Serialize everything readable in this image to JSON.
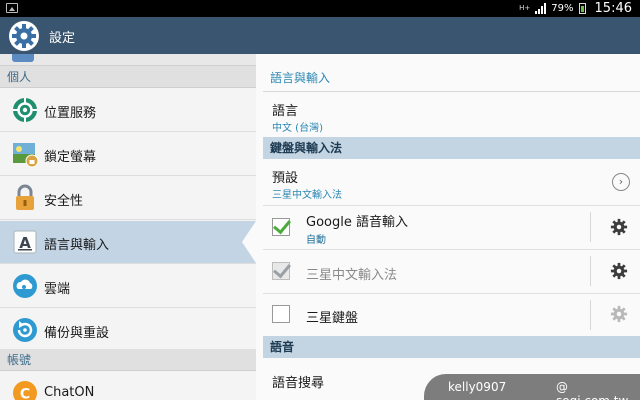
{
  "status_bar": {
    "network": "H+",
    "battery": "79%",
    "time": "15:46"
  },
  "action_bar": {
    "title": "設定",
    "icon": "settings-gear-icon"
  },
  "sidebar": {
    "sections": [
      {
        "label": "個人"
      },
      {
        "label": "帳號"
      }
    ],
    "items": [
      {
        "label": "位置服務",
        "icon": "location-icon"
      },
      {
        "label": "鎖定螢幕",
        "icon": "lock-screen-icon"
      },
      {
        "label": "安全性",
        "icon": "padlock-icon"
      },
      {
        "label": "語言與輸入",
        "icon": "keyboard-a-icon"
      },
      {
        "label": "雲端",
        "icon": "cloud-icon"
      },
      {
        "label": "備份與重設",
        "icon": "backup-reset-icon"
      },
      {
        "label": "ChatON",
        "icon": "chaton-icon"
      }
    ],
    "selected": "語言與輸入"
  },
  "content": {
    "title": "語言與輸入",
    "language": {
      "label": "語言",
      "value": "中文 (台灣)"
    },
    "keyboard_section": "鍵盤與輸入法",
    "default": {
      "label": "預設",
      "value": "三星中文輸入法"
    },
    "input_methods": [
      {
        "label": "Google 語音輸入",
        "sub": "自動",
        "checked": true,
        "enabled": true
      },
      {
        "label": "三星中文輸入法",
        "sub": "",
        "checked": true,
        "enabled": false
      },
      {
        "label": "三星鍵盤",
        "sub": "",
        "checked": false,
        "enabled": true
      }
    ],
    "voice_section": "語音",
    "voice_search": {
      "label": "語音搜尋"
    }
  },
  "watermark": {
    "user": "kelly0907",
    "site": "@ sogi.com.tw"
  },
  "colors": {
    "action_bar": "#3a556f",
    "accent": "#2b87b3",
    "selected_row": "#c3d5e4",
    "check_green": "#4bab3b"
  }
}
